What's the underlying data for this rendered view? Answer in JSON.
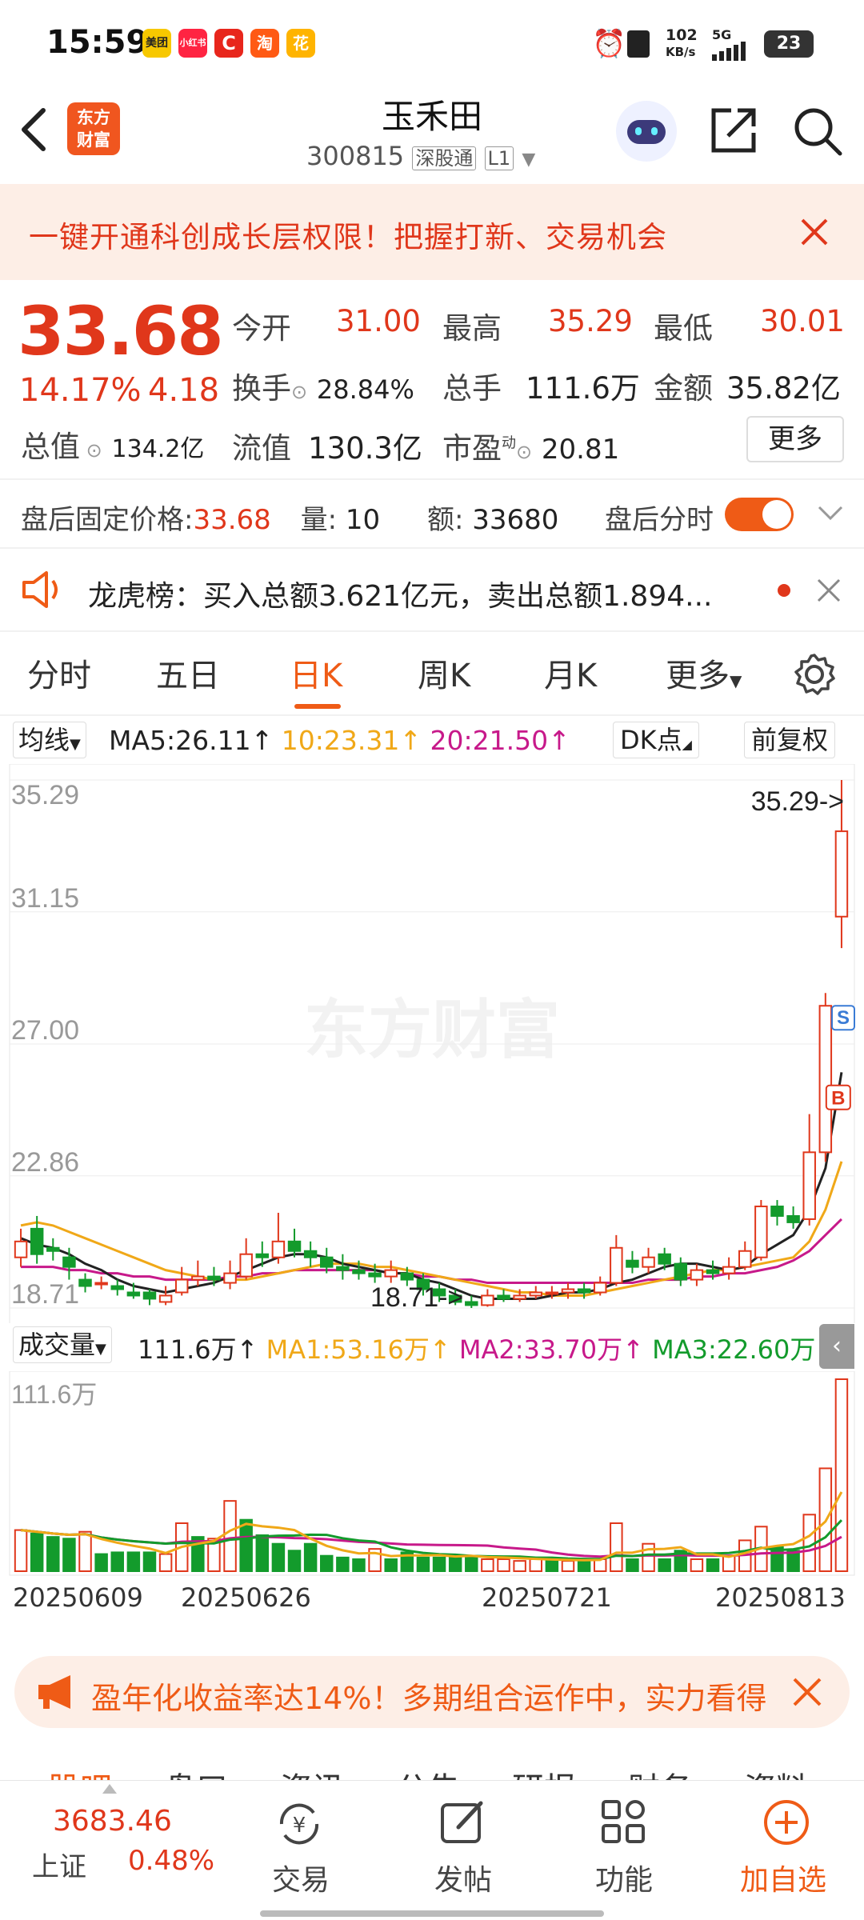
{
  "status_bar": {
    "time": "15:59",
    "apps": [
      "美团",
      "小红书",
      "C",
      "淘",
      "花"
    ],
    "speed_value": "102",
    "speed_unit": "KB/s",
    "network": "5G",
    "battery": "23"
  },
  "header": {
    "back_icon": "chevron-left-icon",
    "logo_line1": "东方",
    "logo_line2": "财富",
    "stock_name": "玉禾田",
    "stock_code": "300815",
    "market_tag": "深股通",
    "level_tag": "L1"
  },
  "banner": {
    "text": "一键开通科创成长层权限！把握打新、交易机会"
  },
  "quote": {
    "price": "33.68",
    "change_pct": "14.17%",
    "change_amt": "4.18",
    "open_label": "今开",
    "open": "31.00",
    "high_label": "最高",
    "high": "35.29",
    "low_label": "最低",
    "low": "30.01",
    "turnover_label": "换手",
    "turnover": "28.84%",
    "volume_label": "总手",
    "volume": "111.6万",
    "amount_label": "金额",
    "amount": "35.82亿",
    "mktcap_label": "总值",
    "mktcap": "134.2亿",
    "float_label": "流值",
    "float_cap": "130.3亿",
    "pe_label": "市盈",
    "pe_sup": "动",
    "pe": "20.81",
    "more": "更多"
  },
  "after_hours": {
    "price_label": "盘后固定价格:",
    "price": "33.68",
    "qty_label": "量:",
    "qty": "10",
    "amt_label": "额:",
    "amt": "33680",
    "toggle_label": "盘后分时",
    "toggle_on": true
  },
  "notice": {
    "text": "龙虎榜：买入总额3.621亿元，卖出总额1.894..."
  },
  "tabs": [
    "分时",
    "五日",
    "日K",
    "周K",
    "月K",
    "更多"
  ],
  "active_tab": "日K",
  "ma_bar": {
    "mode": "均线",
    "ma5": "MA5:26.11",
    "ma10": "10:23.31",
    "ma20": "20:21.50",
    "dk": "DK点",
    "adjust": "前复权"
  },
  "chart_data": [
    {
      "type": "candlestick",
      "watermark": "东方财富",
      "y_ticks": [
        "35.29",
        "31.15",
        "27.00",
        "22.86",
        "18.71"
      ],
      "ylim": [
        18.71,
        35.29
      ],
      "high_marker": "35.29->",
      "low_marker": "18.71->",
      "markers": [
        "B",
        "S"
      ],
      "candles": [
        {
          "o": 20.3,
          "c": 20.8,
          "h": 21.2,
          "l": 20.0
        },
        {
          "o": 21.2,
          "c": 20.4,
          "h": 21.6,
          "l": 20.1
        },
        {
          "o": 20.6,
          "c": 20.5,
          "h": 20.9,
          "l": 20.2
        },
        {
          "o": 20.3,
          "c": 20.0,
          "h": 20.6,
          "l": 19.6
        },
        {
          "o": 19.6,
          "c": 19.4,
          "h": 19.8,
          "l": 19.2
        },
        {
          "o": 19.5,
          "c": 19.5,
          "h": 19.7,
          "l": 19.3
        },
        {
          "o": 19.4,
          "c": 19.3,
          "h": 19.6,
          "l": 19.1
        },
        {
          "o": 19.2,
          "c": 19.1,
          "h": 19.5,
          "l": 19.0
        },
        {
          "o": 19.2,
          "c": 19.0,
          "h": 19.3,
          "l": 18.8
        },
        {
          "o": 18.9,
          "c": 19.1,
          "h": 19.4,
          "l": 18.8
        },
        {
          "o": 19.2,
          "c": 19.6,
          "h": 20.0,
          "l": 19.1
        },
        {
          "o": 19.6,
          "c": 19.7,
          "h": 20.2,
          "l": 19.4
        },
        {
          "o": 19.7,
          "c": 19.6,
          "h": 20.0,
          "l": 19.4
        },
        {
          "o": 19.5,
          "c": 19.8,
          "h": 20.2,
          "l": 19.3
        },
        {
          "o": 19.7,
          "c": 20.4,
          "h": 20.9,
          "l": 19.6
        },
        {
          "o": 20.4,
          "c": 20.3,
          "h": 20.8,
          "l": 20.0
        },
        {
          "o": 20.3,
          "c": 20.8,
          "h": 21.7,
          "l": 20.1
        },
        {
          "o": 20.8,
          "c": 20.5,
          "h": 21.2,
          "l": 20.3
        },
        {
          "o": 20.5,
          "c": 20.3,
          "h": 20.8,
          "l": 20.0
        },
        {
          "o": 20.3,
          "c": 20.0,
          "h": 20.6,
          "l": 19.8
        },
        {
          "o": 20.0,
          "c": 19.9,
          "h": 20.4,
          "l": 19.6
        },
        {
          "o": 19.9,
          "c": 19.8,
          "h": 20.2,
          "l": 19.6
        },
        {
          "o": 19.8,
          "c": 19.7,
          "h": 20.1,
          "l": 19.5
        },
        {
          "o": 19.7,
          "c": 19.9,
          "h": 20.2,
          "l": 19.5
        },
        {
          "o": 19.8,
          "c": 19.6,
          "h": 20.0,
          "l": 19.4
        },
        {
          "o": 19.6,
          "c": 19.3,
          "h": 19.8,
          "l": 19.1
        },
        {
          "o": 19.3,
          "c": 19.1,
          "h": 19.5,
          "l": 18.9
        },
        {
          "o": 19.1,
          "c": 18.9,
          "h": 19.3,
          "l": 18.8
        },
        {
          "o": 18.9,
          "c": 18.8,
          "h": 19.1,
          "l": 18.71
        },
        {
          "o": 18.8,
          "c": 19.1,
          "h": 19.3,
          "l": 18.75
        },
        {
          "o": 19.1,
          "c": 19.0,
          "h": 19.3,
          "l": 18.9
        },
        {
          "o": 19.0,
          "c": 19.1,
          "h": 19.3,
          "l": 18.9
        },
        {
          "o": 19.1,
          "c": 19.2,
          "h": 19.4,
          "l": 19.0
        },
        {
          "o": 19.2,
          "c": 19.2,
          "h": 19.4,
          "l": 19.0
        },
        {
          "o": 19.2,
          "c": 19.3,
          "h": 19.5,
          "l": 19.0
        },
        {
          "o": 19.3,
          "c": 19.2,
          "h": 19.5,
          "l": 19.0
        },
        {
          "o": 19.2,
          "c": 19.5,
          "h": 19.7,
          "l": 19.1
        },
        {
          "o": 19.5,
          "c": 20.6,
          "h": 21.0,
          "l": 19.4
        },
        {
          "o": 20.2,
          "c": 20.0,
          "h": 20.5,
          "l": 19.8
        },
        {
          "o": 20.0,
          "c": 20.3,
          "h": 20.6,
          "l": 19.8
        },
        {
          "o": 20.4,
          "c": 20.1,
          "h": 20.6,
          "l": 19.9
        },
        {
          "o": 20.1,
          "c": 19.6,
          "h": 20.3,
          "l": 19.4
        },
        {
          "o": 19.6,
          "c": 19.9,
          "h": 20.1,
          "l": 19.4
        },
        {
          "o": 19.9,
          "c": 19.8,
          "h": 20.2,
          "l": 19.6
        },
        {
          "o": 19.8,
          "c": 20.0,
          "h": 20.3,
          "l": 19.6
        },
        {
          "o": 20.0,
          "c": 20.5,
          "h": 20.8,
          "l": 19.9
        },
        {
          "o": 20.3,
          "c": 21.9,
          "h": 22.1,
          "l": 20.2
        },
        {
          "o": 21.9,
          "c": 21.6,
          "h": 22.1,
          "l": 21.3
        },
        {
          "o": 21.6,
          "c": 21.4,
          "h": 21.9,
          "l": 21.2
        },
        {
          "o": 21.5,
          "c": 23.6,
          "h": 24.8,
          "l": 21.3
        },
        {
          "o": 23.6,
          "c": 28.2,
          "h": 28.6,
          "l": 23.3
        },
        {
          "o": 31.0,
          "c": 33.68,
          "h": 35.29,
          "l": 30.01
        }
      ],
      "ma5": [
        20.9,
        20.7,
        20.6,
        20.4,
        20.1,
        19.9,
        19.6,
        19.4,
        19.3,
        19.2,
        19.3,
        19.4,
        19.5,
        19.7,
        19.9,
        20.1,
        20.3,
        20.4,
        20.4,
        20.3,
        20.1,
        20.0,
        19.9,
        19.8,
        19.8,
        19.6,
        19.5,
        19.3,
        19.1,
        19.0,
        19.0,
        19.0,
        19.0,
        19.1,
        19.2,
        19.2,
        19.3,
        19.5,
        19.6,
        19.8,
        20.0,
        20.1,
        20.1,
        20.0,
        19.9,
        20.0,
        20.4,
        20.7,
        21.0,
        21.8,
        23.1,
        26.11
      ],
      "ma10": [
        21.3,
        21.4,
        21.3,
        21.1,
        20.9,
        20.7,
        20.5,
        20.3,
        20.1,
        19.9,
        19.8,
        19.7,
        19.6,
        19.6,
        19.6,
        19.7,
        19.8,
        19.9,
        20.0,
        20.1,
        20.1,
        20.1,
        20.0,
        20.0,
        19.9,
        19.8,
        19.7,
        19.6,
        19.5,
        19.4,
        19.3,
        19.2,
        19.2,
        19.1,
        19.1,
        19.1,
        19.2,
        19.3,
        19.4,
        19.5,
        19.6,
        19.7,
        19.8,
        19.9,
        19.9,
        20.0,
        20.1,
        20.2,
        20.3,
        20.8,
        21.8,
        23.31
      ],
      "ma20": [
        20.0,
        20.0,
        20.0,
        19.9,
        19.9,
        19.8,
        19.8,
        19.7,
        19.7,
        19.6,
        19.6,
        19.6,
        19.6,
        19.7,
        19.7,
        19.8,
        19.8,
        19.9,
        19.9,
        19.9,
        19.9,
        19.9,
        19.9,
        19.8,
        19.8,
        19.7,
        19.7,
        19.6,
        19.6,
        19.5,
        19.5,
        19.5,
        19.5,
        19.5,
        19.5,
        19.5,
        19.5,
        19.5,
        19.5,
        19.6,
        19.6,
        19.6,
        19.7,
        19.7,
        19.8,
        19.8,
        19.9,
        20.0,
        20.2,
        20.5,
        21.0,
        21.5
      ]
    },
    {
      "type": "bar",
      "label": "成交量",
      "volume": "111.6万",
      "ma1": "MA1:53.16万",
      "ma2": "MA2:33.70万",
      "ma3": "MA3:22.60万",
      "max_label": "111.6万",
      "x_ticks": [
        "20250609",
        "20250626",
        "20250721",
        "20250813"
      ],
      "values": [
        24,
        22,
        20,
        19,
        23,
        10,
        11,
        11,
        11,
        10,
        28,
        20,
        19,
        41,
        30,
        21,
        16,
        12,
        16,
        9,
        8,
        7,
        13,
        7,
        11,
        8,
        8,
        9,
        9,
        7,
        7,
        6,
        7,
        7,
        6,
        6,
        7,
        28,
        7,
        16,
        7,
        12,
        7,
        7,
        9,
        18,
        26,
        14,
        12,
        33,
        60,
        112
      ],
      "up": [
        1,
        0,
        0,
        0,
        1,
        0,
        0,
        0,
        0,
        1,
        1,
        0,
        1,
        1,
        0,
        0,
        0,
        0,
        0,
        0,
        0,
        0,
        1,
        0,
        0,
        0,
        0,
        0,
        0,
        1,
        1,
        1,
        1,
        0,
        1,
        0,
        1,
        1,
        0,
        1,
        0,
        0,
        1,
        0,
        1,
        1,
        1,
        0,
        0,
        1,
        1,
        1
      ]
    }
  ],
  "promo": {
    "text": "盈年化收益率达14%！多期组合运作中，实力看得"
  },
  "section_tabs": [
    "股吧",
    "盘口",
    "资讯",
    "公告",
    "研报",
    "财务",
    "资料"
  ],
  "bottom_bar": {
    "index_value": "3683.46",
    "index_name": "上证",
    "index_change": "0.48%",
    "trade": "交易",
    "post": "发帖",
    "functions": "功能",
    "add_watch": "加自选"
  }
}
